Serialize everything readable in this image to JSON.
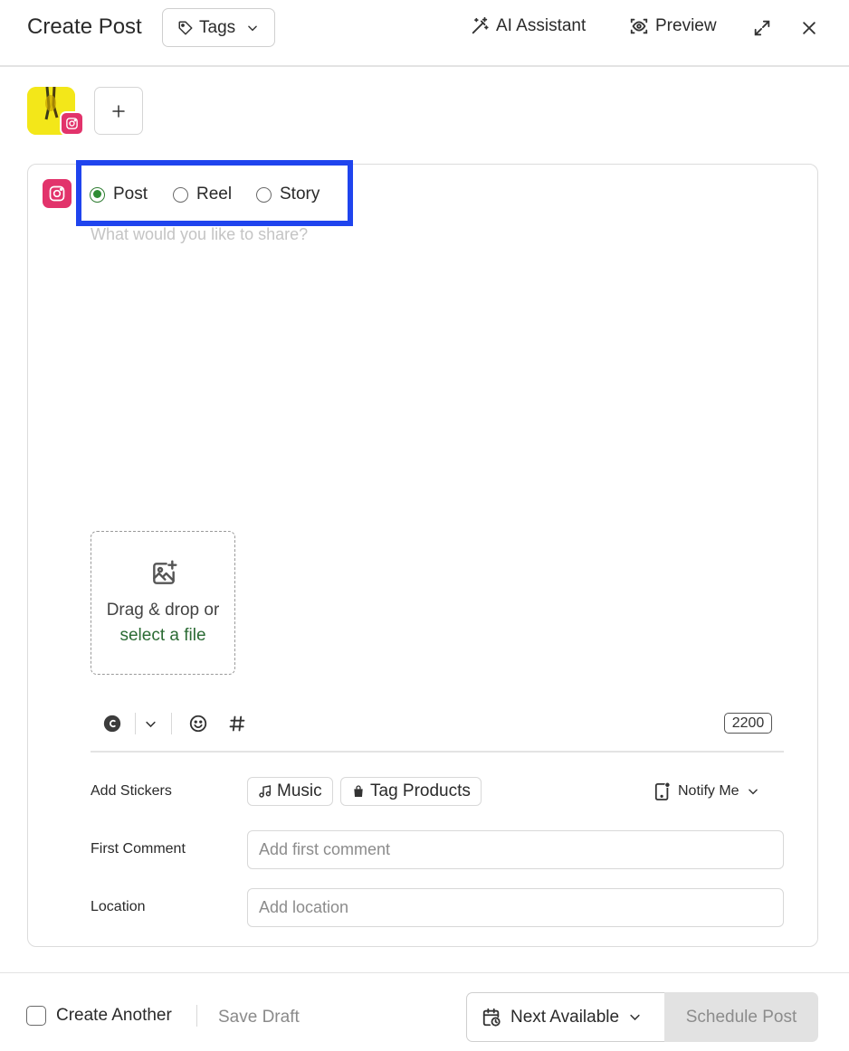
{
  "header": {
    "title": "Create Post",
    "tags_label": "Tags",
    "ai_assistant_label": "AI Assistant",
    "preview_label": "Preview"
  },
  "accounts": {
    "selected": {
      "network": "instagram-icon",
      "avatar_color": "#f3e719",
      "badge_color": "#e2336b"
    },
    "add_label": "+"
  },
  "composer": {
    "network_icon": "instagram-icon",
    "post_types": [
      {
        "label": "Post",
        "selected": true
      },
      {
        "label": "Reel",
        "selected": false
      },
      {
        "label": "Story",
        "selected": false
      }
    ],
    "caption_placeholder": "What would you like to share?",
    "dropzone": {
      "text": "Drag & drop or",
      "link": "select a file"
    },
    "toolbar": {
      "char_limit": "2200"
    },
    "stickers": {
      "label": "Add Stickers",
      "music_label": "Music",
      "tag_products_label": "Tag Products",
      "notify_label": "Notify Me"
    },
    "first_comment": {
      "label": "First Comment",
      "placeholder": "Add first comment"
    },
    "location": {
      "label": "Location",
      "placeholder": "Add location"
    }
  },
  "footer": {
    "create_another_label": "Create Another",
    "save_draft_label": "Save Draft",
    "next_available_label": "Next Available",
    "schedule_label": "Schedule Post"
  },
  "colors": {
    "accent_green": "#2f8c34",
    "instagram_pink": "#e2336b",
    "highlight_blue": "#1f44ee"
  }
}
